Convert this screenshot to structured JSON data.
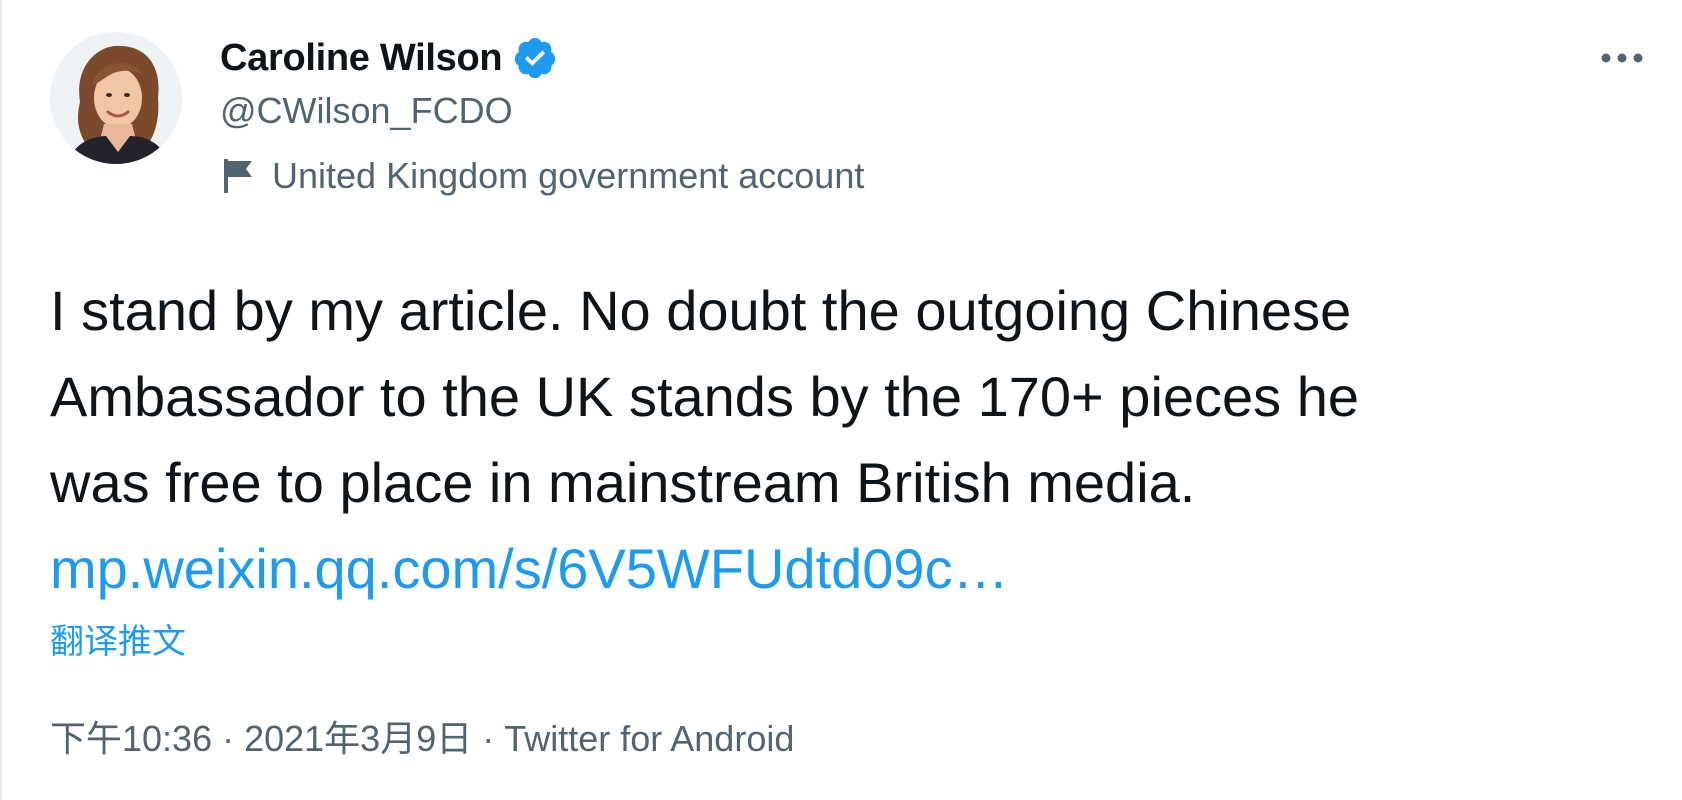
{
  "author": {
    "display_name": "Caroline Wilson",
    "handle": "@CWilson_FCDO",
    "verified": true,
    "account_label": "United Kingdom government account"
  },
  "tweet": {
    "lines": [
      "I stand by my article. No doubt the outgoing Chinese",
      "Ambassador to the UK stands by the 170+ pieces he",
      "was free to place in mainstream British media."
    ],
    "link_text": "mp.weixin.qq.com/s/6V5WFUdtd09c…",
    "translate_label": "翻译推文"
  },
  "meta": {
    "time": "下午10:36",
    "separator": " · ",
    "date": "2021年3月9日",
    "source": "Twitter for Android"
  },
  "icons": {
    "verified": "verified-badge-icon",
    "flag": "flag-icon",
    "more": "more-options-icon"
  },
  "colors": {
    "link": "#1d9bf0",
    "secondary_text": "#536471",
    "primary_text": "#0f1419"
  }
}
